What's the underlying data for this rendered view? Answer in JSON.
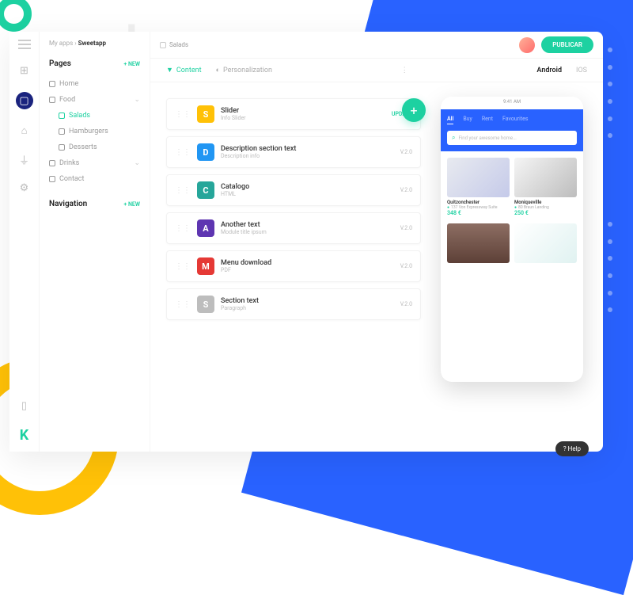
{
  "breadcrumb": {
    "root": "My apps",
    "app": "Sweetapp"
  },
  "header": {
    "page": "Salads",
    "publish": "PUBLICAR"
  },
  "sidebar": {
    "pages_label": "Pages",
    "nav_label": "Navigation",
    "new_label": "+ NEW",
    "items": [
      "Home",
      "Food",
      "Salads",
      "Hamburgers",
      "Desserts",
      "Drinks",
      "Contact"
    ]
  },
  "tabs": {
    "content": "Content",
    "personalization": "Personalization",
    "android": "Android",
    "ios": "IOS"
  },
  "modules": [
    {
      "letter": "S",
      "color": "#ffc107",
      "title": "Slider",
      "sub": "Info Slider",
      "tag": "UPDATE"
    },
    {
      "letter": "D",
      "color": "#2196f3",
      "title": "Description section text",
      "sub": "Description info",
      "tag": "V.2.0"
    },
    {
      "letter": "C",
      "color": "#26a69a",
      "title": "Catalogo",
      "sub": "HTML",
      "tag": "V.2.0"
    },
    {
      "letter": "A",
      "color": "#5e35b1",
      "title": "Another text",
      "sub": "Module title ipsum",
      "tag": "V.2.0"
    },
    {
      "letter": "M",
      "color": "#e53935",
      "title": "Menu download",
      "sub": "PDF",
      "tag": "V.2.0"
    },
    {
      "letter": "S",
      "color": "#bdbdbd",
      "title": "Section text",
      "sub": "Paragraph",
      "tag": "V.2.0"
    }
  ],
  "phone": {
    "tabs": [
      "All",
      "Buy",
      "Rent",
      "Favourites"
    ],
    "search": "Find your awesome home...",
    "cards": [
      {
        "name": "Quitzonchester",
        "loc": "137 Von Expressway Suite",
        "price": "348 €"
      },
      {
        "name": "Moniqueville",
        "loc": "80 Braun Landing",
        "price": "250 €"
      }
    ]
  },
  "help": "? Help"
}
